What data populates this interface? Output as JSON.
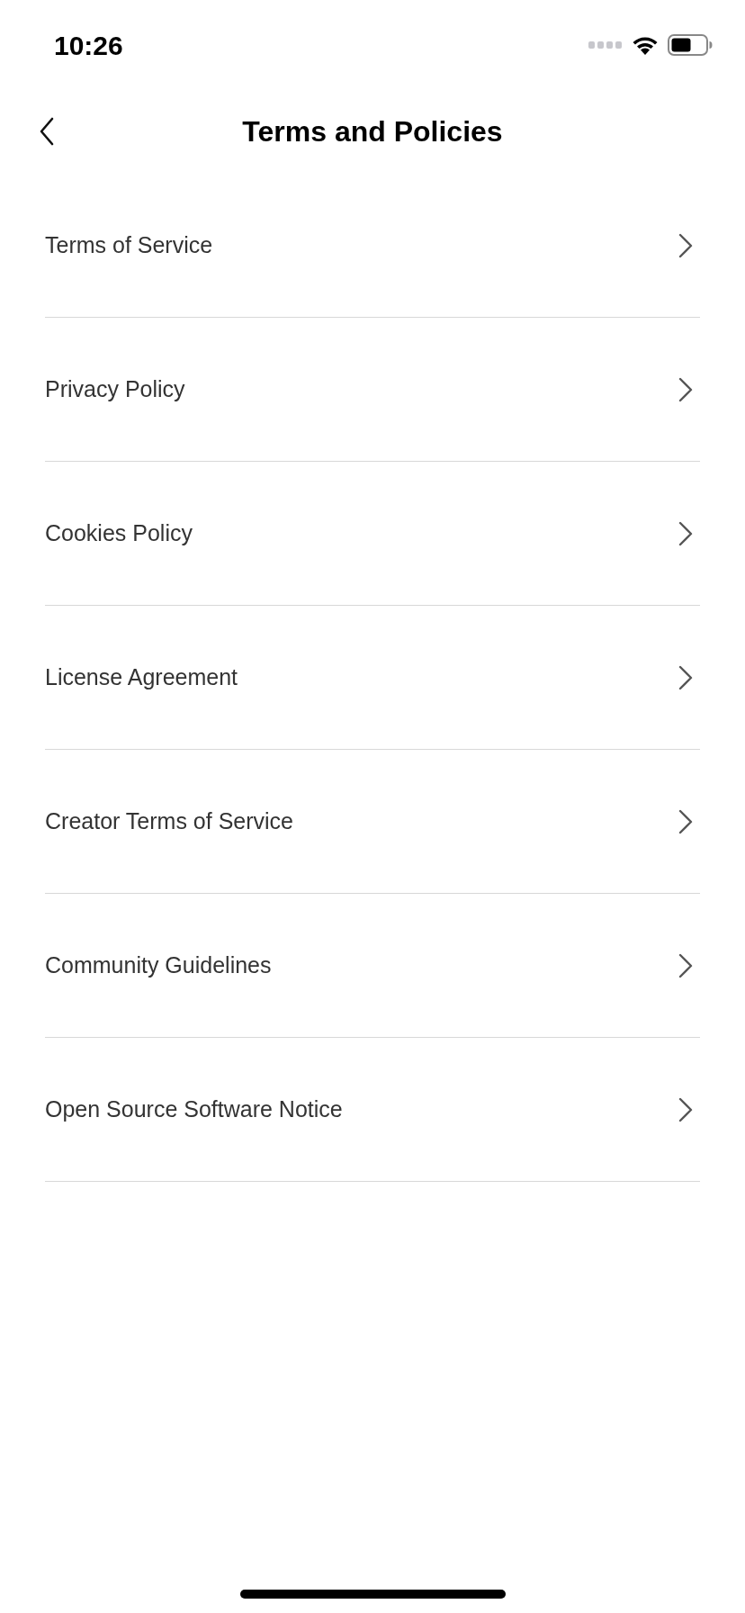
{
  "status_bar": {
    "time": "10:26"
  },
  "header": {
    "title": "Terms and Policies"
  },
  "items": [
    {
      "label": "Terms of Service"
    },
    {
      "label": "Privacy Policy"
    },
    {
      "label": "Cookies Policy"
    },
    {
      "label": "License Agreement"
    },
    {
      "label": "Creator Terms of Service"
    },
    {
      "label": "Community Guidelines"
    },
    {
      "label": "Open Source Software Notice"
    }
  ]
}
